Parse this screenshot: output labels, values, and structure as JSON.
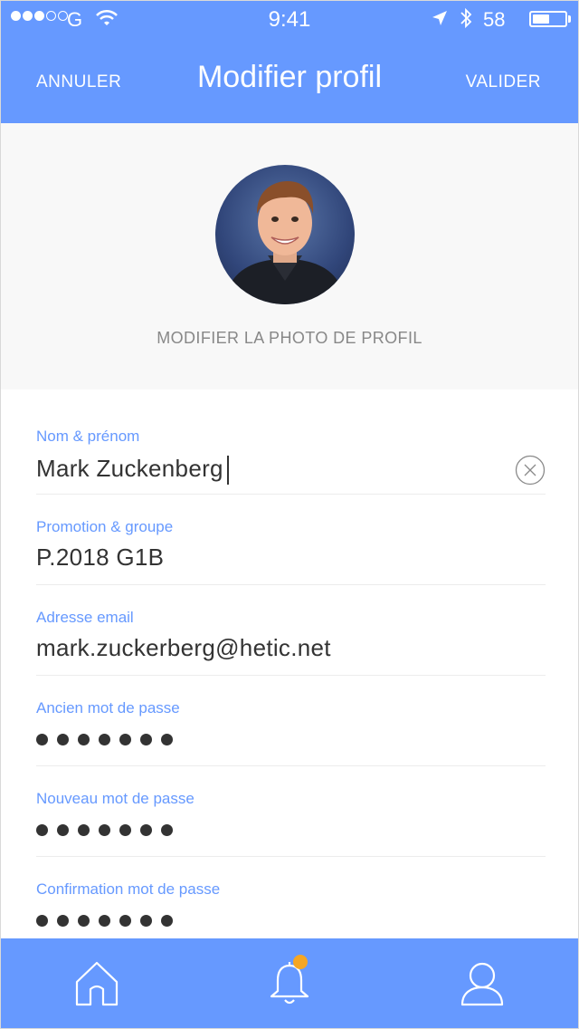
{
  "status_bar": {
    "carrier": "G",
    "time": "9:41",
    "battery_percent": "58",
    "battery_level": 0.58
  },
  "header": {
    "cancel_label": "ANNULER",
    "title": "Modifier profil",
    "confirm_label": "VALIDER",
    "background_color": "#6699ff"
  },
  "profile": {
    "change_photo_label": "MODIFIER LA PHOTO DE PROFIL"
  },
  "form": {
    "fields": [
      {
        "label": "Nom & prénom",
        "value": "Mark Zuckenberg"
      },
      {
        "label": "Promotion & groupe",
        "value": "P.2018 G1B"
      },
      {
        "label": "Adresse email",
        "value": "mark.zuckerberg@hetic.net"
      },
      {
        "label": "Ancien mot de passe",
        "value": "•••••••"
      },
      {
        "label": "Nouveau mot de passe",
        "value": "•••••••"
      },
      {
        "label": "Confirmation mot de passe",
        "value": "•••••••"
      }
    ]
  },
  "tabbar": {
    "items": [
      {
        "icon": "home-icon"
      },
      {
        "icon": "bell-icon",
        "has_badge": true
      },
      {
        "icon": "user-icon"
      }
    ],
    "badge_color": "#f5a623"
  }
}
